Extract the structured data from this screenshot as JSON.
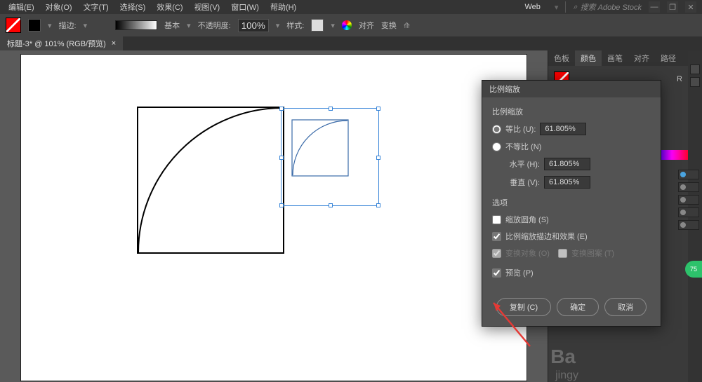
{
  "menubar": {
    "items": [
      "编辑(E)",
      "对象(O)",
      "文字(T)",
      "选择(S)",
      "效果(C)",
      "视图(V)",
      "窗口(W)",
      "帮助(H)"
    ]
  },
  "top_right": {
    "web_label": "Web",
    "search_placeholder": "搜索 Adobe Stock"
  },
  "toolbar": {
    "stroke_label": "描边:",
    "basic_label": "基本",
    "opacity_label": "不透明度:",
    "opacity_value": "100%",
    "style_label": "样式:",
    "align_label": "对齐",
    "transform_label": "变换"
  },
  "doc_tab": {
    "title": "标题-3* @ 101% (RGB/预览)"
  },
  "panels": {
    "tabs": [
      "色板",
      "颜色",
      "画笔",
      "对齐",
      "路径"
    ],
    "r_label": "R"
  },
  "dialog": {
    "title": "比例缩放",
    "section_scale": "比例缩放",
    "uniform_label": "等比 (U):",
    "uniform_value": "61.805%",
    "nonuniform_label": "不等比 (N)",
    "horizontal_label": "水平 (H):",
    "horizontal_value": "61.805%",
    "vertical_label": "垂直 (V):",
    "vertical_value": "61.805%",
    "section_options": "选项",
    "scale_corners": "缩放圆角 (S)",
    "scale_strokes": "比例缩放描边和效果 (E)",
    "transform_objects": "变换对象 (O)",
    "transform_patterns": "变换图案 (T)",
    "preview": "预览 (P)",
    "btn_copy": "复制 (C)",
    "btn_ok": "确定",
    "btn_cancel": "取消"
  },
  "watermark": {
    "line1": "Ba",
    "line2": "jingy"
  },
  "badge": "75"
}
